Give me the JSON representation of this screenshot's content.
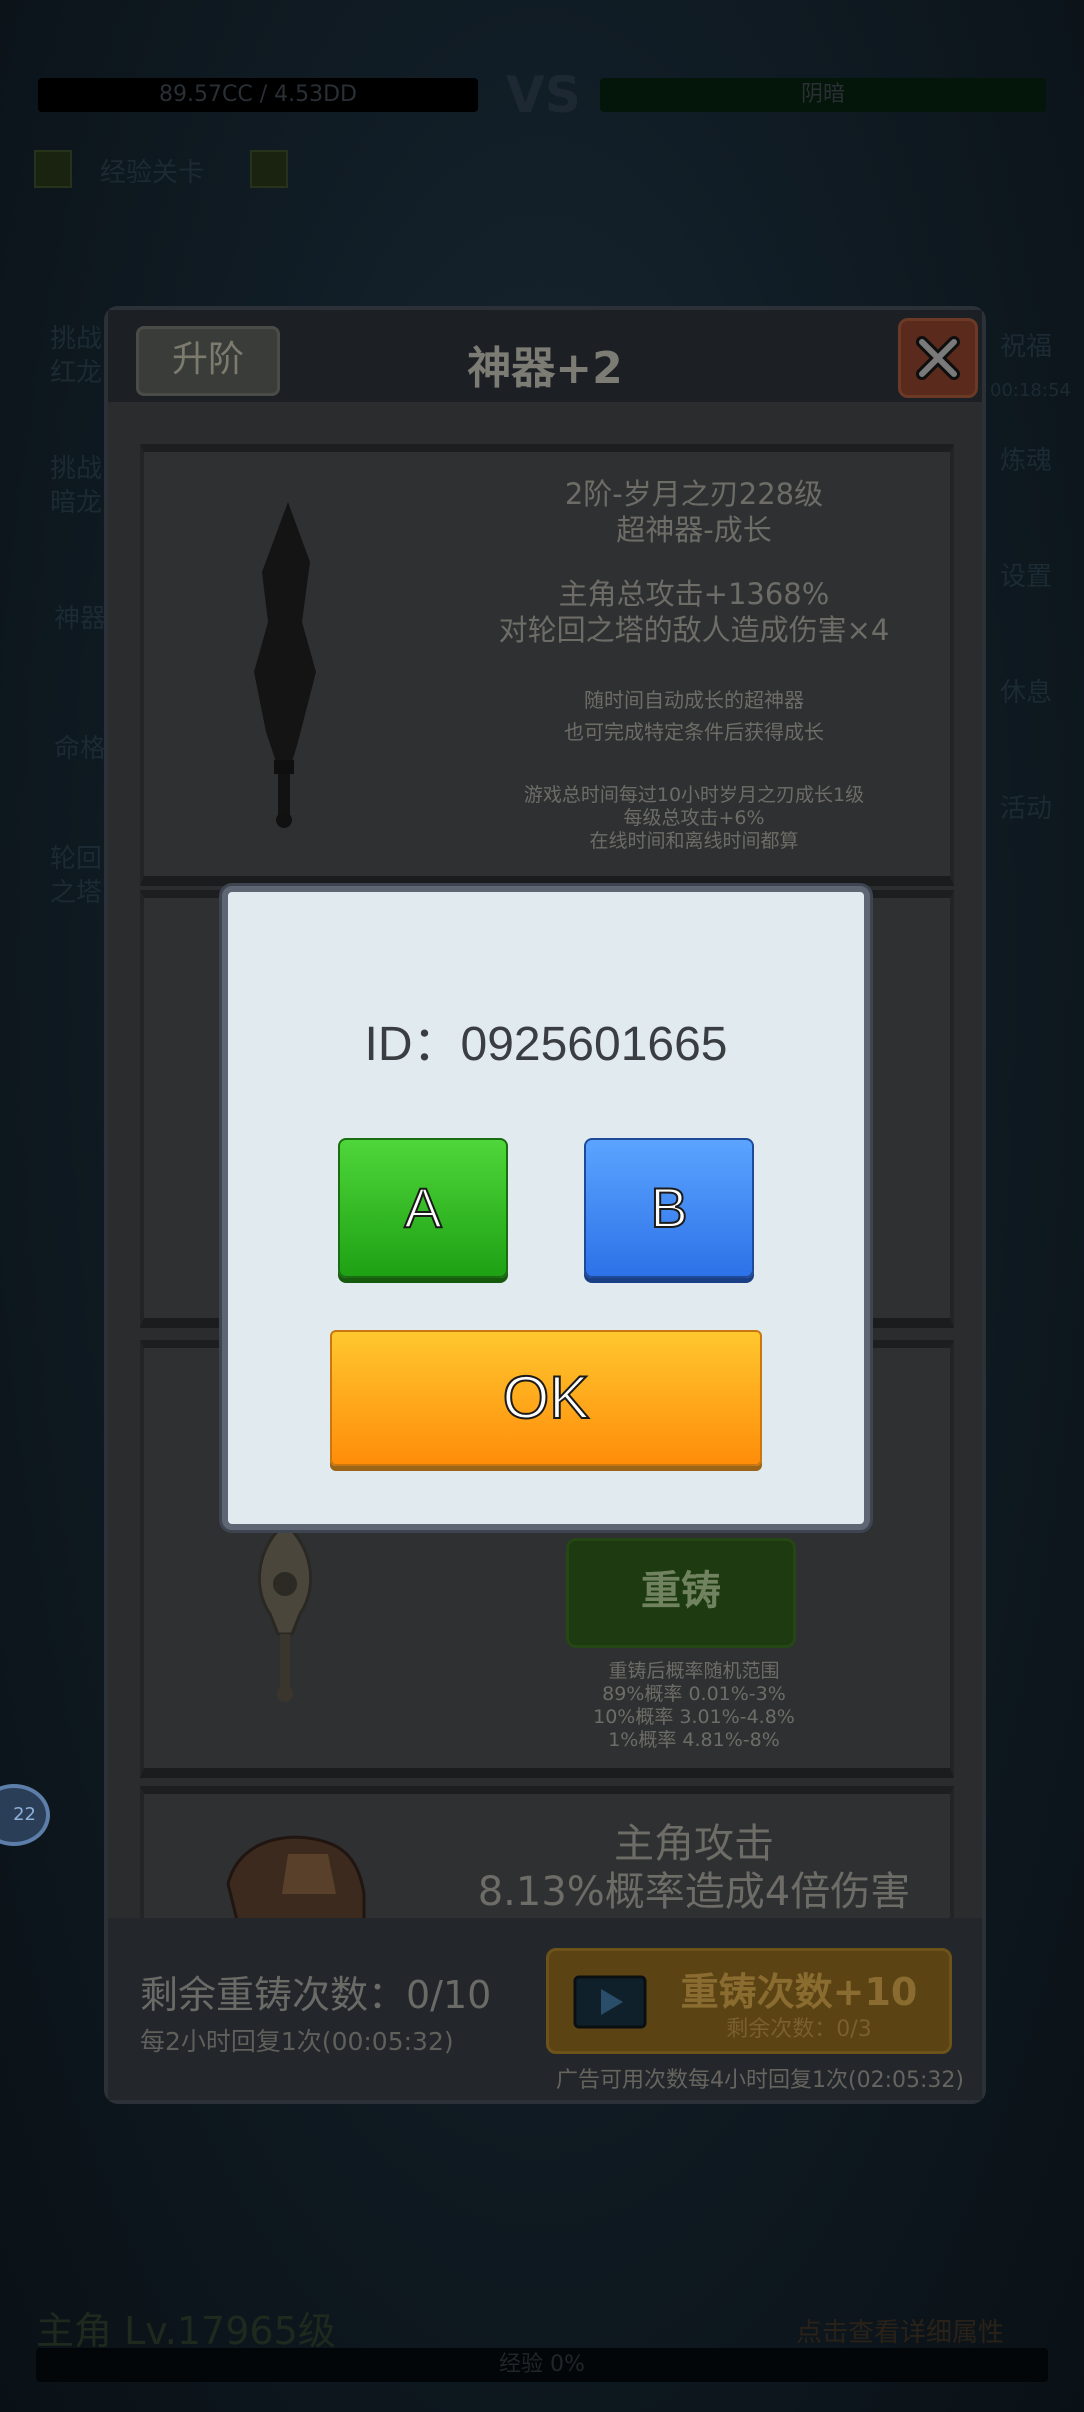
{
  "background": {
    "player_hp": "89.57CC / 4.53DD",
    "vs": "VS",
    "enemy_hp": "阴暗",
    "stage_label": "经验关卡",
    "left_menu": [
      "挑战\n红龙",
      "挑战\n暗龙",
      "神器",
      "命格",
      "轮回\n之塔"
    ],
    "right_menu": [
      "祝福",
      "炼魂",
      "设置",
      "休息",
      "活动"
    ],
    "right_timer": "00:18:54",
    "bottom_level": "主角 Lv.17965级",
    "bottom_right": "点击查看详细属性",
    "exp": "经验 0%",
    "side_badge": "22"
  },
  "panel": {
    "upgrade_button": "升阶",
    "title": "神器+2",
    "card1": {
      "name": "2阶-岁月之刃228级",
      "type": "超神器-成长",
      "stat1": "主角总攻击+1368%",
      "stat2": "对轮回之塔的敌人造成伤害×4",
      "desc1": "随时间自动成长的超神器",
      "desc2": "也可完成特定条件后获得成长",
      "note1": "游戏总时间每过10小时岁月之刃成长1级",
      "note2": "每级总攻击+6%",
      "note3": "在线时间和离线时间都算"
    },
    "card3": {
      "recast_button": "重铸",
      "range_title": "重铸后概率随机范围",
      "range1": "89%概率 0.01%-3%",
      "range2": "10%概率 3.01%-4.8%",
      "range3": "1%概率 4.81%-8%"
    },
    "card4": {
      "line1": "主角攻击",
      "line2": "8.13%概率造成4倍伤害"
    },
    "footer": {
      "remaining": "剩余重铸次数：0/10",
      "recover": "每2小时回复1次(00:05:32)",
      "ad_title": "重铸次数+10",
      "ad_sub": "剩余次数：0/3",
      "ad_note": "广告可用次数每4小时回复1次(02:05:32)"
    }
  },
  "dialog": {
    "id_text": "ID：0925601665",
    "button_a": "A",
    "button_b": "B",
    "ok": "OK"
  },
  "colors": {
    "button_a": "#2bb51f",
    "button_b": "#3c86f5",
    "ok": "#ffa31a",
    "dialog_bg": "#e1ebef"
  }
}
